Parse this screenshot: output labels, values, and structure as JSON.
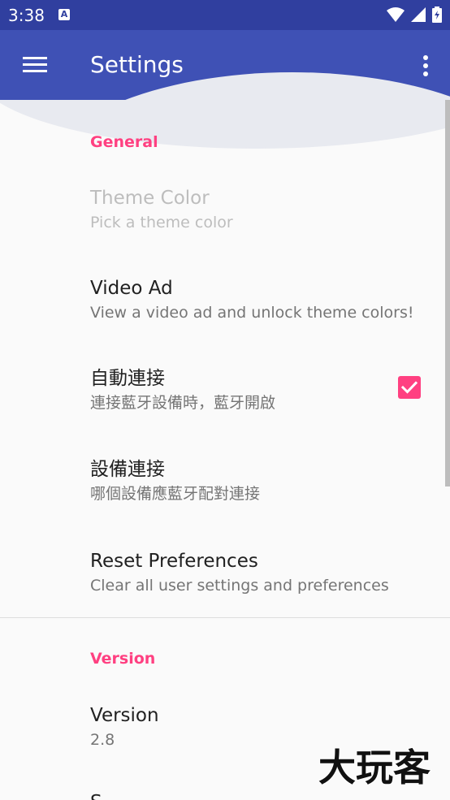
{
  "status_bar": {
    "time": "3:38",
    "notification_icon": "a-notification-icon",
    "icons": [
      "wifi-icon",
      "signal-icon",
      "battery-icon"
    ]
  },
  "app_bar": {
    "title": "Settings",
    "nav_icon": "menu-icon",
    "action_icon": "more-vert-icon"
  },
  "general": {
    "header": "General",
    "items": [
      {
        "title": "Theme Color",
        "summary": "Pick a theme color",
        "enabled": false
      },
      {
        "title": "Video Ad",
        "summary": "View a video ad and unlock theme colors!",
        "enabled": true
      },
      {
        "title": "自動連接",
        "summary": "連接藍牙設備時，藍牙開啟",
        "enabled": true,
        "checked": true
      },
      {
        "title": "設備連接",
        "summary": "哪個設備應藍牙配對連接",
        "enabled": true
      },
      {
        "title": "Reset Preferences",
        "summary": "Clear all user settings and preferences",
        "enabled": true
      }
    ]
  },
  "version": {
    "header": "Version",
    "items": [
      {
        "title": "Version",
        "summary": "2.8"
      },
      {
        "title": "S"
      }
    ]
  },
  "watermark": {
    "text": "大玩客"
  },
  "colors": {
    "status_bar": "#303f9f",
    "app_bar": "#3f51b5",
    "accent": "#ff4081",
    "background": "#fafafa"
  }
}
